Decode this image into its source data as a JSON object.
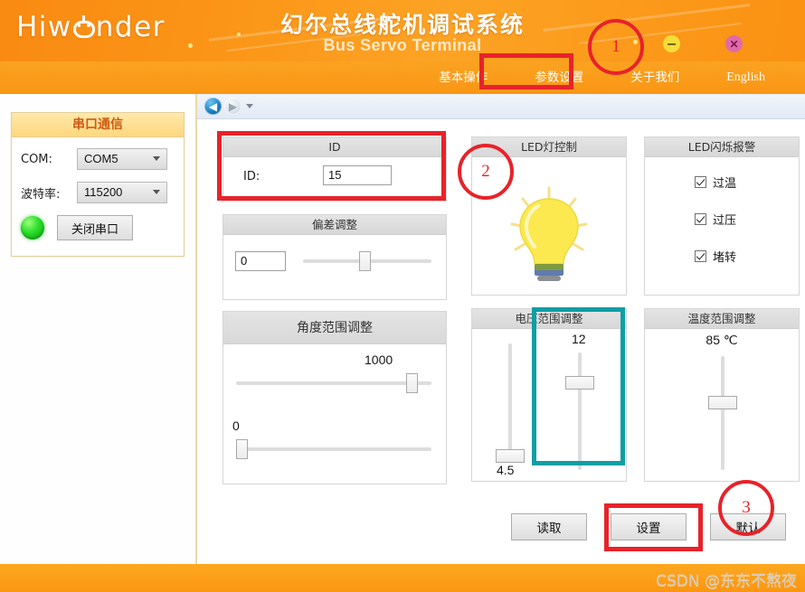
{
  "window": {
    "brand": "Hiwonder",
    "title_cn": "幻尔总线舵机调试系统",
    "title_en": "Bus Servo Terminal",
    "minimize_label": "",
    "close_label": "✕"
  },
  "nav": {
    "items": [
      {
        "label": "基本操作",
        "name": "tab-basic-operation",
        "active": false
      },
      {
        "label": "参数设置",
        "name": "tab-parameter-settings",
        "active": true
      },
      {
        "label": "关于我们",
        "name": "tab-about-us",
        "active": false
      },
      {
        "label": "English",
        "name": "tab-english",
        "active": false
      }
    ]
  },
  "toolbar": {
    "back_glyph": "◀",
    "forward_glyph": "▶"
  },
  "sidebar": {
    "serial_panel": {
      "title": "串口通信",
      "com_label": "COM:",
      "com_value": "COM5",
      "baud_label": "波特率:",
      "baud_value": "115200",
      "connect_button": "关闭串口",
      "status_indicator": "connected"
    }
  },
  "panels": {
    "id": {
      "title": "ID",
      "field_label": "ID:",
      "value": "15"
    },
    "deviation": {
      "title": "偏差调整",
      "value": "0",
      "slider_percent": 50
    },
    "angle_range": {
      "title": "角度范围调整",
      "max_value": "1000",
      "max_slider_percent": 100,
      "min_value": "0",
      "min_slider_percent": 0
    },
    "led_control": {
      "title": "LED灯控制",
      "bulb_state": "on"
    },
    "led_alarm": {
      "title": "LED闪烁报警",
      "items": [
        {
          "label": "过温",
          "checked": true
        },
        {
          "label": "过压",
          "checked": true
        },
        {
          "label": "堵转",
          "checked": true
        }
      ]
    },
    "voltage_range": {
      "title": "电压范围调整",
      "min_value": "4.5",
      "min_slider_percent": 3,
      "max_value": "12",
      "max_slider_percent": 80
    },
    "temperature_range": {
      "title": "温度范围调整",
      "value": "85 ℃",
      "slider_percent": 72
    }
  },
  "actions": {
    "read_button": "读取",
    "set_button": "设置",
    "default_button": "默认"
  },
  "annotations": [
    {
      "id": "1",
      "label": "1"
    },
    {
      "id": "2",
      "label": "2"
    },
    {
      "id": "3",
      "label": "3"
    }
  ],
  "watermark": "CSDN @东东不熬夜",
  "colors": {
    "brand_orange": "#fb9516",
    "annotation_red": "#e8222a",
    "highlight_teal": "#0f9ea4",
    "status_green": "#2ee02e"
  }
}
